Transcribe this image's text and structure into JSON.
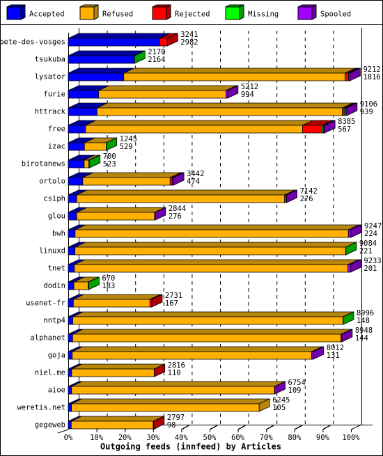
{
  "legend": [
    {
      "label": "Accepted",
      "color": "#0000FF",
      "dark": "#0000A0"
    },
    {
      "label": "Refused",
      "color": "#FFB000",
      "dark": "#B8860B"
    },
    {
      "label": "Rejected",
      "color": "#FF0000",
      "dark": "#B00000"
    },
    {
      "label": "Missing",
      "color": "#00FF00",
      "dark": "#00A000"
    },
    {
      "label": "Spooled",
      "color": "#A000FF",
      "dark": "#7000A8"
    }
  ],
  "chart_data": {
    "type": "bar",
    "orientation": "horizontal",
    "stacked": true,
    "title": "",
    "xlabel": "Outgoing feeds (innfeed) by Articles",
    "ylabel": "",
    "xlim_percent": [
      0,
      100
    ],
    "x_ticks": [
      "0%",
      "10%",
      "20%",
      "30%",
      "40%",
      "50%",
      "60%",
      "70%",
      "80%",
      "90%",
      "100%"
    ],
    "grid": "vertical dashed",
    "legend_position": "top",
    "categories": [
      "bete-des-vosges",
      "tsukuba",
      "lysator",
      "furie",
      "httrack",
      "free",
      "izac",
      "birotanews",
      "ortolo",
      "csiph",
      "glou",
      "bwh",
      "linuxd",
      "tnet",
      "dodin",
      "usenet-fr",
      "nntp4",
      "alphanet",
      "goja",
      "niel.me",
      "aioe",
      "weretis.net",
      "gegeweb"
    ],
    "totals": [
      3241,
      2170,
      9212,
      5212,
      9106,
      8385,
      1245,
      700,
      3442,
      7142,
      2844,
      9247,
      9084,
      9233,
      670,
      2731,
      8996,
      8948,
      8012,
      2816,
      6754,
      6245,
      2797
    ],
    "series": [
      {
        "name": "Accepted",
        "values": [
          2982,
          2164,
          1816,
          994,
          939,
          567,
          529,
          523,
          474,
          276,
          276,
          224,
          221,
          201,
          183,
          167,
          148,
          144,
          131,
          110,
          109,
          105,
          98
        ]
      },
      {
        "name": "Refused",
        "values": [
          0,
          0,
          7236,
          4163,
          8027,
          7095,
          711,
          145,
          2858,
          6800,
          2548,
          8938,
          8855,
          8947,
          471,
          2505,
          8841,
          8777,
          7833,
          2701,
          6638,
          6140,
          2681
        ]
      },
      {
        "name": "Rejected",
        "values": [
          259,
          0,
          70,
          0,
          60,
          645,
          0,
          0,
          76,
          0,
          0,
          0,
          0,
          0,
          0,
          59,
          0,
          0,
          0,
          5,
          0,
          0,
          18
        ]
      },
      {
        "name": "Missing",
        "values": [
          0,
          6,
          45,
          0,
          35,
          38,
          5,
          32,
          0,
          0,
          0,
          0,
          8,
          0,
          16,
          0,
          7,
          0,
          0,
          0,
          0,
          0,
          0
        ]
      },
      {
        "name": "Spooled",
        "values": [
          0,
          0,
          45,
          55,
          45,
          40,
          0,
          0,
          34,
          66,
          20,
          85,
          0,
          85,
          0,
          0,
          0,
          27,
          48,
          0,
          7,
          0,
          0
        ]
      }
    ]
  }
}
